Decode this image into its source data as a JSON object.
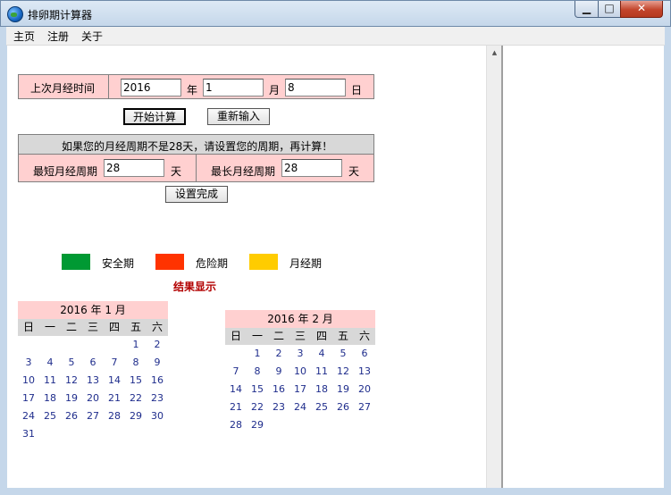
{
  "window": {
    "title": "排卵期计算器"
  },
  "menu": [
    "主页",
    "注册",
    "关于"
  ],
  "last_period": {
    "label": "上次月经时间",
    "year": "2016",
    "year_unit": "年",
    "month": "1",
    "month_unit": "月",
    "day": "8",
    "day_unit": "日"
  },
  "buttons": {
    "start": "开始计算",
    "reset": "重新输入",
    "done": "设置完成"
  },
  "cycle": {
    "note": "如果您的月经周期不是28天，请设置您的周期，再计算！",
    "min_label": "最短月经周期",
    "min_value": "28",
    "max_label": "最长月经周期",
    "max_value": "28",
    "unit": "天"
  },
  "legend": [
    {
      "label": "安全期",
      "color": "#009933"
    },
    {
      "label": "危险期",
      "color": "#ff3300"
    },
    {
      "label": "月经期",
      "color": "#ffcc00"
    }
  ],
  "result_title": "结果显示",
  "calendars": [
    {
      "title": "2016 年 1 月",
      "weekdays": [
        "日",
        "一",
        "二",
        "三",
        "四",
        "五",
        "六"
      ],
      "weeks": [
        [
          "",
          "",
          "",
          "",
          "",
          "1",
          "2"
        ],
        [
          "3",
          "4",
          "5",
          "6",
          "7",
          "8",
          "9"
        ],
        [
          "10",
          "11",
          "12",
          "13",
          "14",
          "15",
          "16"
        ],
        [
          "17",
          "18",
          "19",
          "20",
          "21",
          "22",
          "23"
        ],
        [
          "24",
          "25",
          "26",
          "27",
          "28",
          "29",
          "30"
        ],
        [
          "31",
          "",
          "",
          "",
          "",
          "",
          ""
        ]
      ]
    },
    {
      "title": "2016 年 2 月",
      "weekdays": [
        "日",
        "一",
        "二",
        "三",
        "四",
        "五",
        "六"
      ],
      "weeks": [
        [
          "",
          "1",
          "2",
          "3",
          "4",
          "5",
          "6"
        ],
        [
          "7",
          "8",
          "9",
          "10",
          "11",
          "12",
          "13"
        ],
        [
          "14",
          "15",
          "16",
          "17",
          "18",
          "19",
          "20"
        ],
        [
          "21",
          "22",
          "23",
          "24",
          "25",
          "26",
          "27"
        ],
        [
          "28",
          "29",
          "",
          "",
          "",
          "",
          ""
        ]
      ]
    }
  ]
}
